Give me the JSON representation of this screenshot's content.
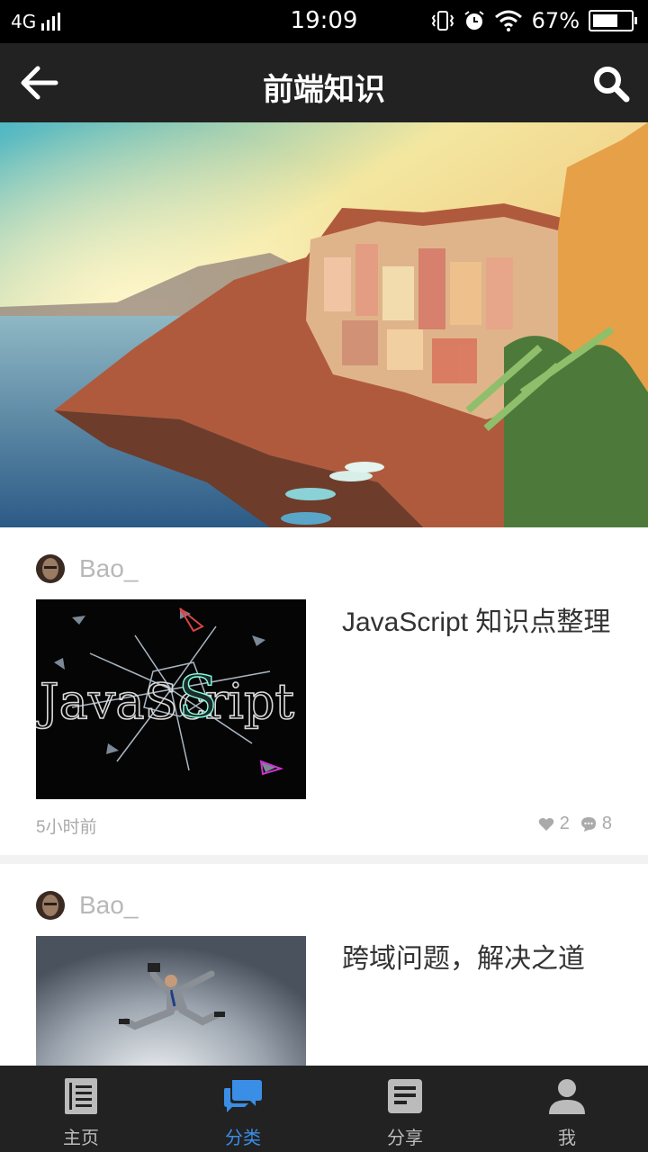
{
  "status_bar": {
    "network": "4G",
    "time": "19:09",
    "battery_percent": "67%",
    "battery_level": 0.67
  },
  "app_bar": {
    "title": "前端知识",
    "back_icon": "arrow-left-icon",
    "search_icon": "search-icon"
  },
  "articles": [
    {
      "author": "Bao_",
      "title": "JavaScript 知识点整理",
      "time": "5小时前",
      "likes": "2",
      "comments": "8"
    },
    {
      "author": "Bao_",
      "title": "跨域问题，解决之道"
    }
  ],
  "bottom_nav": [
    {
      "label": "主页",
      "icon": "document-icon",
      "active": false
    },
    {
      "label": "分类",
      "icon": "chat-bubbles-icon",
      "active": true
    },
    {
      "label": "分享",
      "icon": "note-icon",
      "active": false
    },
    {
      "label": "我",
      "icon": "person-icon",
      "active": false
    }
  ],
  "colors": {
    "active": "#3a8ee6",
    "bar_bg": "#222222"
  }
}
